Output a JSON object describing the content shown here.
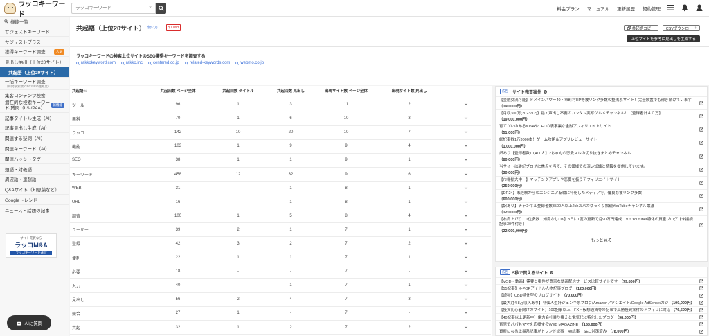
{
  "header": {
    "logo_text": "ラッコキーワード",
    "search_placeholder": "ラッコキーワード",
    "nav": [
      "料金プラン",
      "マニュアル",
      "更新履歴",
      "契約管理"
    ]
  },
  "sidebar": {
    "title": "機能一覧",
    "items": [
      {
        "label": "サジェストキーワード"
      },
      {
        "label": "サジェストプラス"
      },
      {
        "label": "獲得キーワード調査",
        "badge": "人気"
      },
      {
        "label": "見出し抽出（上位20サイト）"
      },
      {
        "label": "共起語（上位20サイト）",
        "active": true
      },
      {
        "label": "一括キーワード調査",
        "sub": "（月間検索数/CPC/SEO難易度）"
      },
      {
        "label": "集客コンテンツ検索"
      },
      {
        "label": "潜在的な検索キーワード/質問（LSI/PAA）",
        "badge": "新機能"
      },
      {
        "label": "記事タイトル生成（AI）"
      },
      {
        "label": "記事見出し生成（AI）"
      },
      {
        "label": "関連する疑問（AI）"
      },
      {
        "label": "関連キーワード（AI）"
      },
      {
        "label": "関連ハッシュタグ"
      },
      {
        "label": "類語・対義語"
      },
      {
        "label": "周辺語・連想語"
      },
      {
        "label": "Q&Aサイト（知恵袋など）"
      },
      {
        "label": "Googleトレンド"
      },
      {
        "label": "ニュース・話題の記事"
      }
    ],
    "banner": {
      "top": "サイト売買なら",
      "main": "ラッコM&A",
      "bottom": "ラッコキーワード運営"
    },
    "ai_button": "AIに質問"
  },
  "main": {
    "title": "共起語（上位20サイト）",
    "how_to": "使い方",
    "cost": "$1 usd",
    "buttons": {
      "copy": "共起語コピー",
      "csv": "CSVダウンロード",
      "generate": "上位サイトを参考に見出しを生成する"
    },
    "info_heading": "ラッコキーワードの検索上位サイトのSEO獲得キーワードを調査する",
    "sites": [
      "rakkokeyword.com",
      "rakko.inc",
      "centered.co.jp",
      "related-keywords.com",
      "webmo.co.jp"
    ]
  },
  "table": {
    "headers": [
      "共起語",
      "共起回数 ページ全体",
      "共起回数 タイトル",
      "共起回数 見出し",
      "出現サイト数 ページ全体",
      "出現サイト数 見出し"
    ],
    "rows": [
      [
        "ツール",
        "96",
        "1",
        "3",
        "11",
        "2"
      ],
      [
        "無料",
        "70",
        "1",
        "6",
        "10",
        "3"
      ],
      [
        "ラッコ",
        "142",
        "10",
        "20",
        "10",
        "7"
      ],
      [
        "機能",
        "103",
        "1",
        "9",
        "9",
        "4"
      ],
      [
        "SEO",
        "38",
        "1",
        "1",
        "9",
        "1"
      ],
      [
        "キーワード",
        "458",
        "12",
        "32",
        "9",
        "6"
      ],
      [
        "WEB",
        "31",
        "-",
        "1",
        "8",
        "1"
      ],
      [
        "URL",
        "16",
        "-",
        "1",
        "8",
        "1"
      ],
      [
        "調査",
        "100",
        "1",
        "5",
        "8",
        "4"
      ],
      [
        "ユーザー",
        "39",
        "2",
        "1",
        "7",
        "1"
      ],
      [
        "登録",
        "42",
        "3",
        "2",
        "7",
        "2"
      ],
      [
        "便利",
        "22",
        "1",
        "1",
        "7",
        "1"
      ],
      [
        "必要",
        "18",
        "-",
        "-",
        "7",
        "-"
      ],
      [
        "入力",
        "40",
        "-",
        "1",
        "7",
        "1"
      ],
      [
        "見出し",
        "56",
        "2",
        "4",
        "7",
        "3"
      ],
      [
        "競合",
        "27",
        "1",
        "-",
        "7",
        "-"
      ],
      [
        "共起",
        "32",
        "1",
        "2",
        "7",
        "2"
      ],
      [
        "サジェスト",
        "146",
        "1",
        "7",
        "7",
        "4"
      ]
    ]
  },
  "right_panel": {
    "section1_title": "サイト売買案件",
    "listings": [
      {
        "title": "【金融交流可能】ドメインパワー40・市町村HP等被リンク多数の整備系サイト！完全放置でも稼ぎ続けています",
        "price": "（190,000円）"
      },
      {
        "title": "【月収300万(2023/12)】指・声出し不要のカンタン実写グルメチャンネル！【登録者計４０万】",
        "price": "（19,000,000円）"
      },
      {
        "title": "育てがいのあるNISAやCFDの表事業な金融アフィリエイトサイト",
        "price": "（51,000円）"
      },
      {
        "title": "総記事数1万3000本！ゲーム攻略＆アプリレビューサイト",
        "price": "（1,000,000円）"
      },
      {
        "title": "訳あり【登録者数10,400人】2ちゃんの恋愛スレの切り抜きまとめチャンネル",
        "price": "（80,000円）"
      },
      {
        "title": "当サイトは雑記ブログに焦点を当て、その領域での深い知識と情報を提供しています。",
        "price": "（30,000円）"
      },
      {
        "title": "【市場拡大中！】マッチングアプリや恋愛を扱うアフィリエイトサイト",
        "price": "（250,000円）"
      },
      {
        "title": "【DR24】未経験からのエンジニア転職に特化したメディアで、優良な被リンク多数",
        "price": "（600,000円）"
      },
      {
        "title": "【訳あり】チャンネル登録者数3500人以上2chおバカゆっくり解説YouTubeチャンネル譲渡",
        "price": "（120,000円）"
      },
      {
        "title": "【右肩上がり：1位多数｜知識なしOK】3日に1度の更新で月90万円達成：V・Youtuber特化の資産ブログ【未接続記事30件付き】",
        "price": "（22,000,000円）"
      }
    ],
    "more": "もっと見る",
    "section2_title": "5秒で買えるサイト",
    "quick_sites": [
      {
        "title": "【VOD・動画】需要と案件が豊富な動画配信サービス比較サイトです",
        "price": "（79,800円）"
      },
      {
        "title": "【55記事】K-POPアイドル人物記事ブログ",
        "price": "（120,000円）"
      },
      {
        "title": "【読物】CBD特化型のブログサイト",
        "price": "（70,000円）"
      },
      {
        "title": "【最大月4.8万収入あり】非個人生計ジェンキ系ブログ(Amazonアソシエイト/Google AdSense/ガジェット系アフィ)",
        "price": "（100,000円）"
      },
      {
        "title": "【投資初心者向けのサイト】100記事以上　FX・仮想通貨等の記事で高勝投資案件のアフィリに対応",
        "price": "（76,500円）"
      },
      {
        "title": "【40記事以上更新中】電力会社乗り換えと電気代に特化したブログ",
        "price": "（98,000円）"
      },
      {
        "title": "育児でパパもママを応援するWEB MAGAZINE",
        "price": "（153,600円）"
      },
      {
        "title": "資産になる上場系記事がトレンド記事　40記事　SEO対策済み",
        "price": "（78,000円）"
      }
    ]
  }
}
